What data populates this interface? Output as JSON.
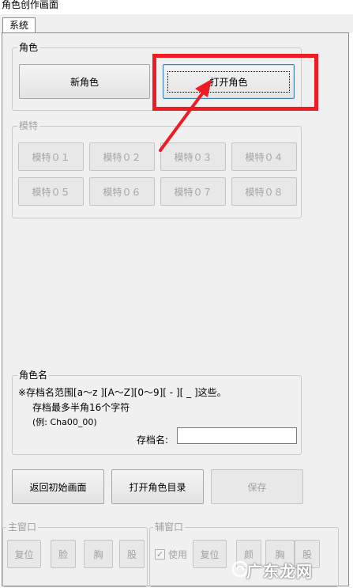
{
  "window": {
    "title": "角色创作画面"
  },
  "tabs": [
    {
      "label": "系统"
    }
  ],
  "character_group": {
    "legend": "角色",
    "new_button": "新角色",
    "open_button": "打开角色"
  },
  "model_group": {
    "legend": "模特",
    "buttons": [
      "模特０１",
      "模特０２",
      "模特０３",
      "模特０４",
      "模特０５",
      "模特０６",
      "模特０７",
      "模特０８"
    ]
  },
  "name_group": {
    "legend": "角色名",
    "note_line1": "※存档名范围[a～z ][A～Z][0～9][ - ][ _ ]这些。",
    "note_line2": "存档最多半角16个字符",
    "note_line3": "(例: Cha00_00)",
    "field_label": "存档名:",
    "field_value": ""
  },
  "actions": {
    "back_button": "返回初始画面",
    "open_dir_button": "打开角色目录",
    "save_button": "保存"
  },
  "main_window_group": {
    "legend": "主窗口",
    "buttons": [
      "复位",
      "脸",
      "胸",
      "股"
    ]
  },
  "sub_window_group": {
    "legend": "辅窗口",
    "use_label": "使用",
    "buttons": [
      "复位",
      "颜",
      "胸",
      "股"
    ]
  },
  "watermark": {
    "text": "广东龙网"
  },
  "colors": {
    "highlight": "#ee1c25",
    "panel": "#f0f0f0"
  }
}
